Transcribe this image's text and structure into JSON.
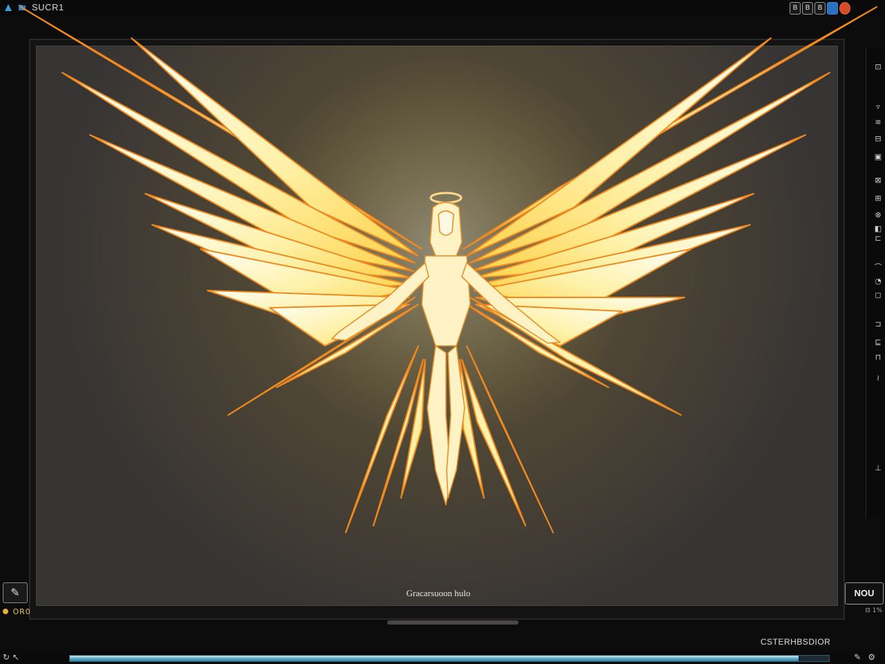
{
  "app": {
    "title": "SUCR1",
    "window_buttons": [
      "B",
      "B",
      "B"
    ]
  },
  "canvas": {
    "caption": "Gracarsuoon hulo"
  },
  "tools": {
    "left_tool_icon": "pen-icon",
    "left_tool_glyph": "✎",
    "left_status": "OR0"
  },
  "side_panel": {
    "icons": [
      "⊡",
      "▿",
      "≋",
      "⊟",
      "▣",
      "⊠",
      "⊞",
      "⊗",
      "◧",
      "⊏",
      "⌒",
      "◔",
      "◻",
      "⊐",
      "⊑",
      "⊓",
      "≀",
      "⊥"
    ]
  },
  "right_controls": {
    "button_label": "NOU",
    "small_label": "⊟ 1%"
  },
  "status": {
    "text": "CSTERHBSDIOR",
    "progress": 0.96
  },
  "colors": {
    "canvas_bg": "#373434",
    "wing_glow": "#ffd23a",
    "wing_edge": "#ff8a1e",
    "progress": "#5aa8c6"
  }
}
